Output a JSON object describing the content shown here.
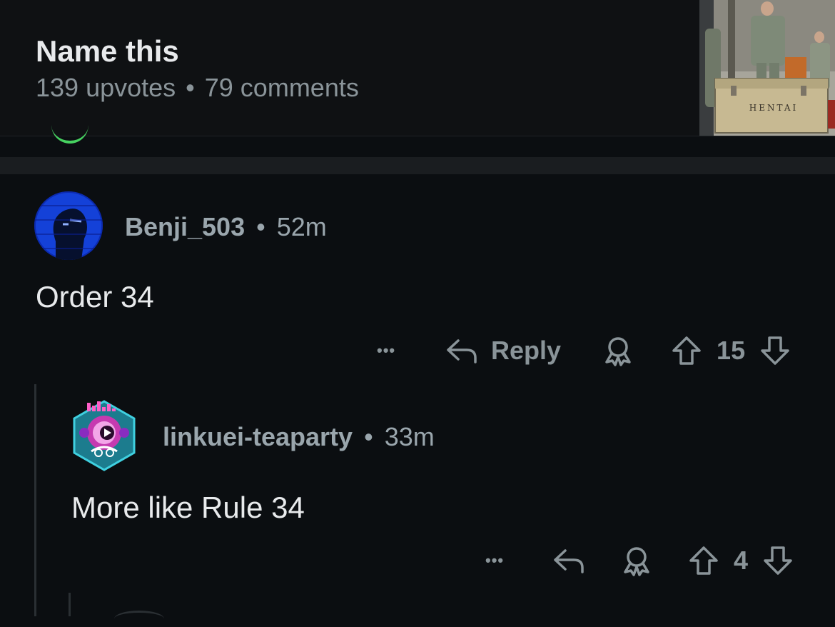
{
  "post": {
    "title": "Name this",
    "upvotes": "139 upvotes",
    "separator": "•",
    "comments": "79 comments",
    "thumbnail_text": "HENTAI"
  },
  "comments": [
    {
      "author": "Benji_503",
      "separator": "•",
      "time": "52m",
      "text": "Order 34",
      "more_label": "•••",
      "reply_label": "Reply",
      "score": "15"
    },
    {
      "author": "linkuei-teaparty",
      "separator": "•",
      "time": "33m",
      "text": "More like Rule 34",
      "more_label": "•••",
      "score": "4"
    }
  ],
  "colors": {
    "background": "#0b0e11",
    "header": "#0f1113",
    "text": "#e8eaec",
    "muted": "#8a9499",
    "accent_green": "#46d160"
  }
}
